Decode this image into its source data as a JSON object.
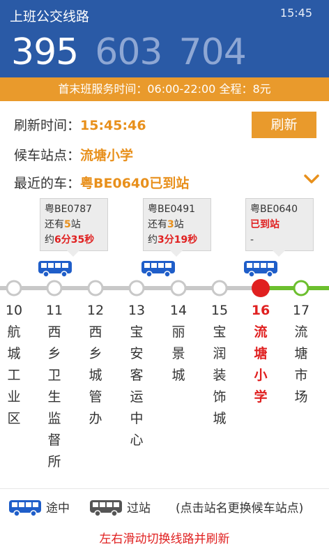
{
  "header": {
    "title": "上班公交线路",
    "time": "15:45",
    "routes": [
      {
        "label": "395",
        "active": true
      },
      {
        "label": "603",
        "active": false
      },
      {
        "label": "704",
        "active": false
      }
    ]
  },
  "service_bar": {
    "text": "首末班服务时间：06:00-22:00 全程：8元"
  },
  "info": {
    "refresh_label": "刷新时间：",
    "refresh_time": "15:45:46",
    "refresh_button": "刷新",
    "station_label": "候车站点：",
    "station_value": "流塘小学",
    "nearest_label": "最近的车：",
    "nearest_value": "粤BE0640已到站"
  },
  "buses": [
    {
      "plate": "粤BE0787",
      "remain_pre": "还有",
      "remain_num": "5",
      "remain_suf": "站",
      "eta_pre": "约",
      "eta": "6分35秒"
    },
    {
      "plate": "粤BE0491",
      "remain_pre": "还有",
      "remain_num": "3",
      "remain_suf": "站",
      "eta_pre": "约",
      "eta": "3分19秒"
    },
    {
      "plate": "粤BE0640",
      "status": "已到站",
      "eta": "-"
    }
  ],
  "stops": [
    {
      "num": "10",
      "name": "航城工业区"
    },
    {
      "num": "11",
      "name": "西乡卫生监督所"
    },
    {
      "num": "12",
      "name": "西乡城管办"
    },
    {
      "num": "13",
      "name": "宝安客运中心"
    },
    {
      "num": "14",
      "name": "丽景城"
    },
    {
      "num": "15",
      "name": "宝润装饰城"
    },
    {
      "num": "16",
      "name": "流塘小学"
    },
    {
      "num": "17",
      "name": "流塘市场"
    }
  ],
  "legend": {
    "en_route": "途中",
    "passed": "过站",
    "hint": "(点击站名更换候车站点)"
  },
  "footer": {
    "text": "左右滑动切换线路并刷新"
  },
  "colors": {
    "header_bg": "#2a5aa6",
    "accent_orange": "#e99a2c",
    "bus_blue": "#1f5ec9",
    "current_red": "#e02020",
    "ahead_green": "#6cbf2e",
    "passed_gray": "#c8c8c8"
  }
}
